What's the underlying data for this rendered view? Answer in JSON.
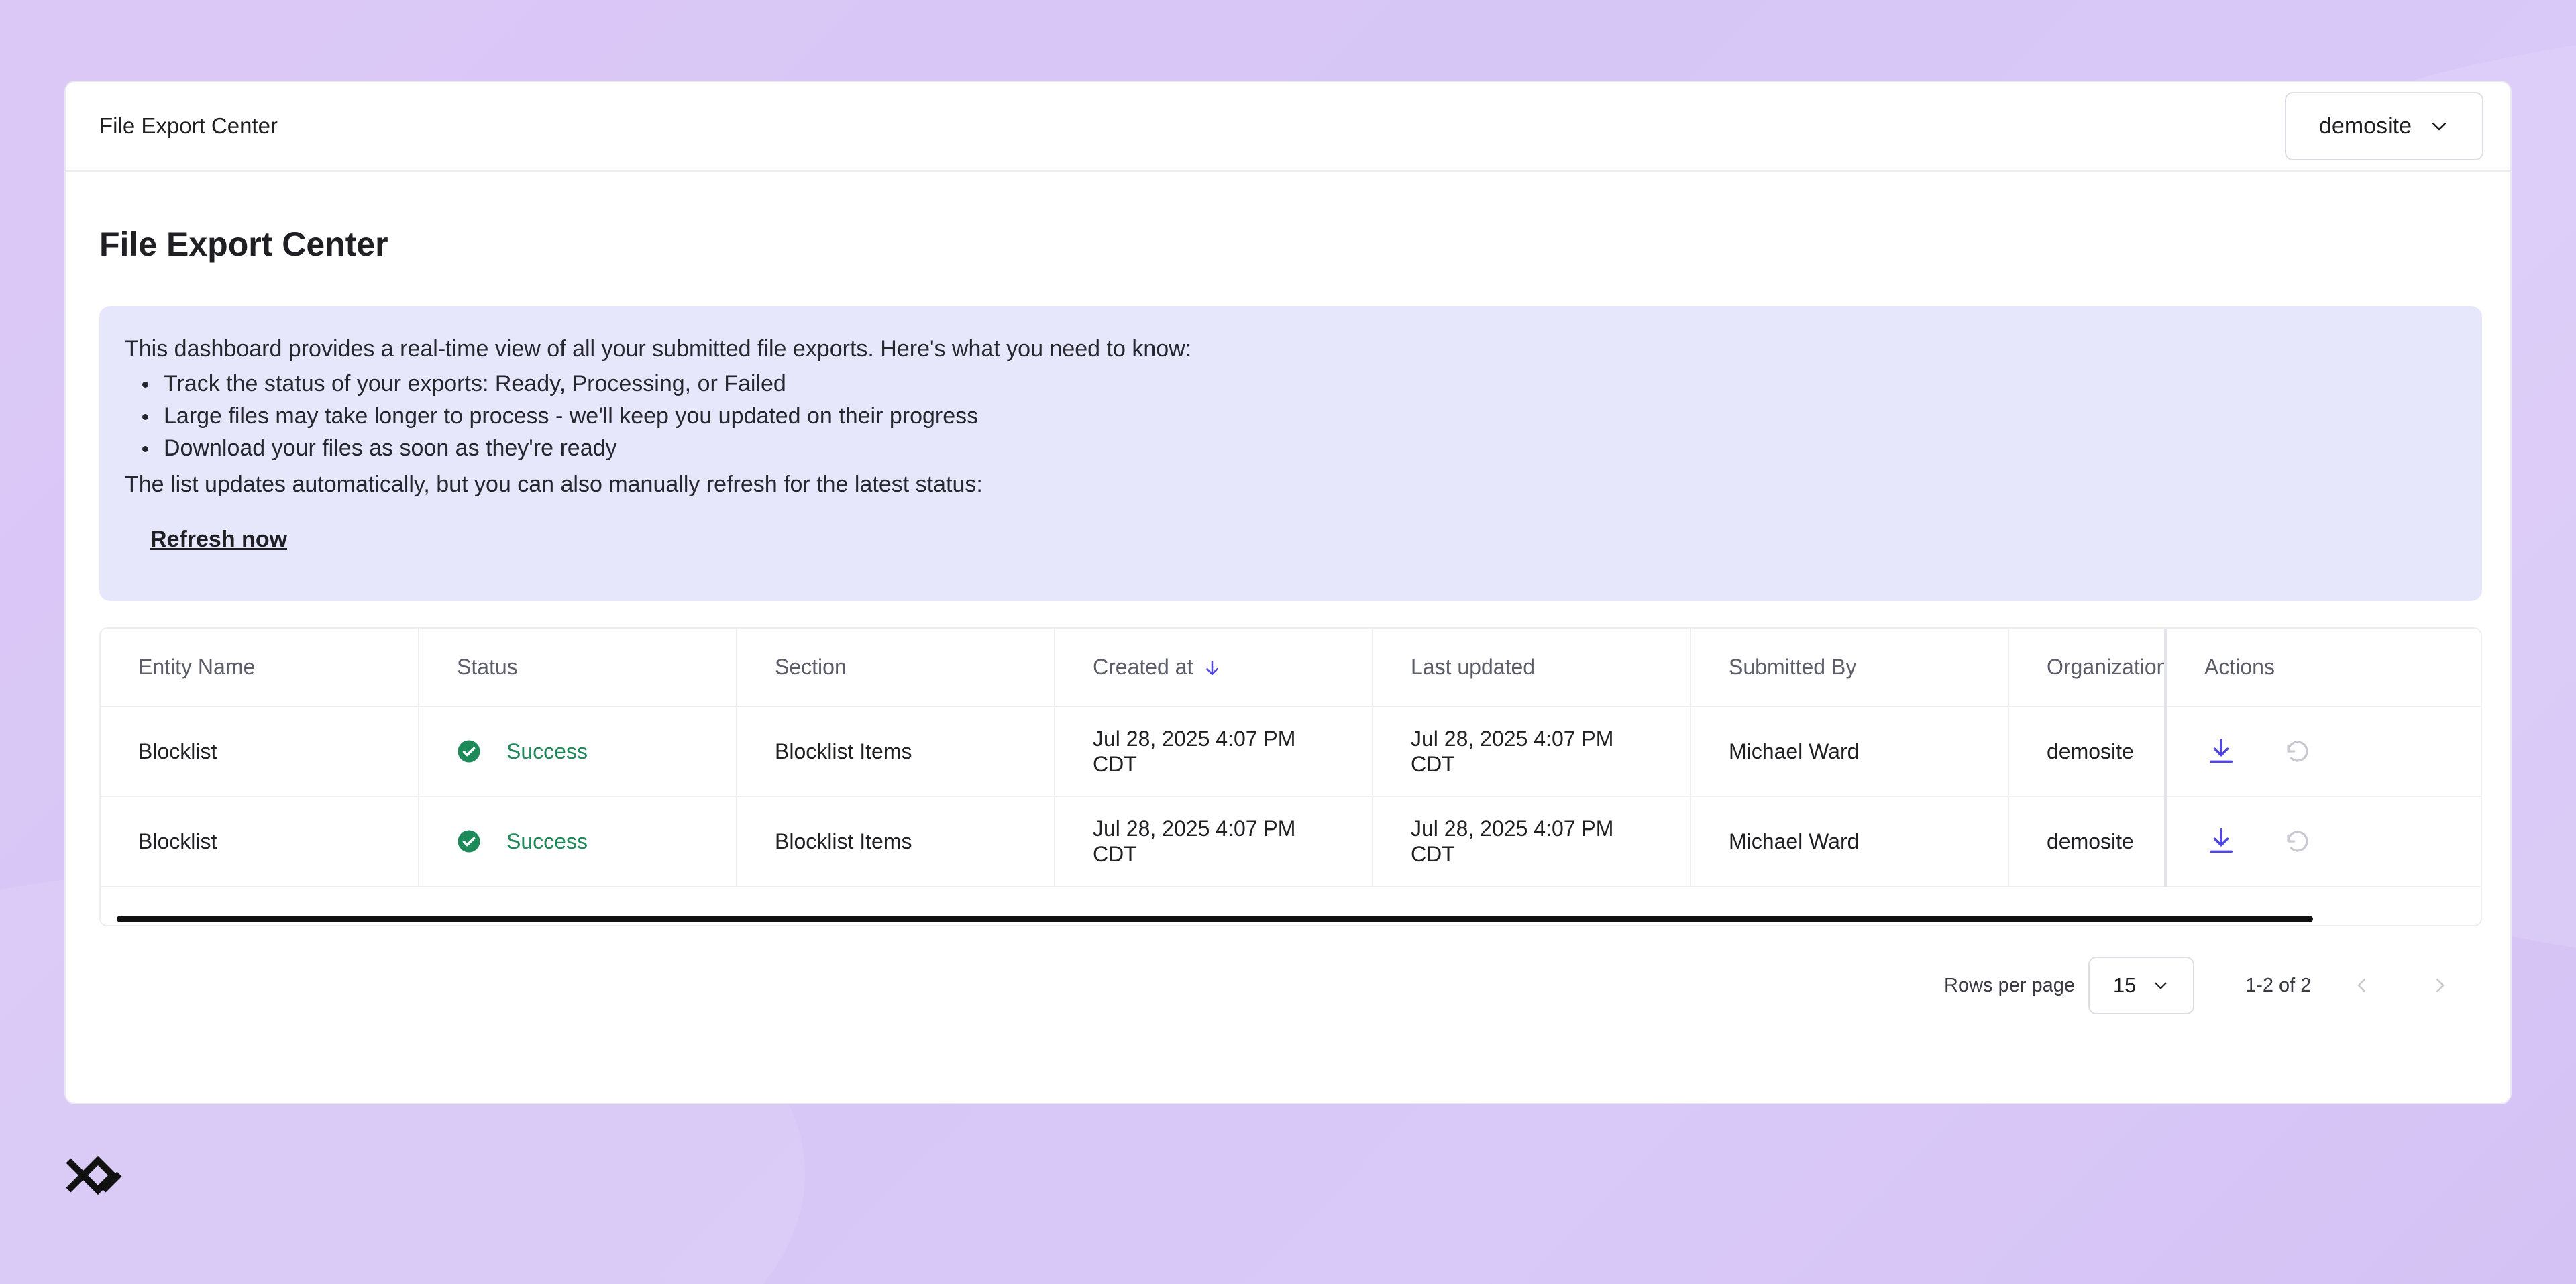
{
  "topbar": {
    "title": "File Export Center",
    "site_select": {
      "value": "demosite",
      "icon": "chevron-down-icon"
    }
  },
  "page": {
    "title": "File Export Center"
  },
  "info": {
    "intro": "This dashboard provides a real-time view of all your submitted file exports. Here's what you need to know:",
    "bullets": [
      "Track the status of your exports: Ready, Processing, or Failed",
      "Large files may take longer to process - we'll keep you updated on their progress",
      "Download your files as soon as they're ready"
    ],
    "outro": "The list updates automatically, but you can also manually refresh for the latest status:",
    "refresh_label": "Refresh now"
  },
  "table": {
    "columns": [
      "Entity Name",
      "Status",
      "Section",
      "Created at",
      "Last updated",
      "Submitted By",
      "Organization",
      "Actions"
    ],
    "sort_icon": "arrow-down-icon",
    "rows": [
      {
        "entity_name": "Blocklist",
        "status": "Success",
        "section": "Blocklist Items",
        "created_at": "Jul 28, 2025 4:07 PM CDT",
        "last_updated": "Jul 28, 2025 4:07 PM CDT",
        "submitted_by": "Michael Ward",
        "organization": "demosite"
      },
      {
        "entity_name": "Blocklist",
        "status": "Success",
        "section": "Blocklist Items",
        "created_at": "Jul 28, 2025 4:07 PM CDT",
        "last_updated": "Jul 28, 2025 4:07 PM CDT",
        "submitted_by": "Michael Ward",
        "organization": "demosite"
      }
    ]
  },
  "pagination": {
    "rows_per_page_label": "Rows per page",
    "rows_per_page_value": "15",
    "range": "1-2 of 2"
  },
  "colors": {
    "accent": "#4f46e5",
    "success": "#1d8a5a",
    "info_bg": "#e6e7fb"
  }
}
